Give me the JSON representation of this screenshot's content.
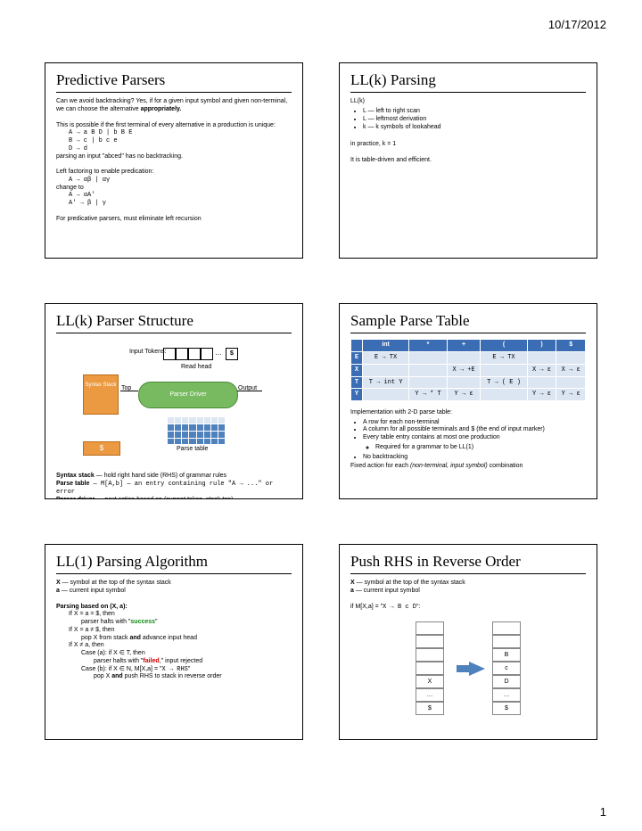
{
  "header_date": "10/17/2012",
  "footer_page": "1",
  "s1": {
    "title": "Predictive Parsers",
    "p1a": "Can we avoid backtracking? Yes, if for a given input symbol and given non-terminal, we can choose the alternative ",
    "p1b": "appropriately.",
    "p2": "This is possible if the first terminal of every alternative in a production is unique:",
    "prod1": "A → a B D | b B E",
    "prod2": "B → c | b c e",
    "prod3": "D → d",
    "p3": "parsing an input \"abced\" has no backtracking.",
    "p4": "Left factoring to enable predication:",
    "prod4": "A → αβ | αγ",
    "p5": "change to",
    "prod5": "A → αA'",
    "prod6": "A' → β | γ",
    "p6": "For predicative parsers, must eliminate left recursion"
  },
  "s2": {
    "title": "LL(k) Parsing",
    "h": "LL(k)",
    "li1": "L — left to right scan",
    "li2": "L — leftmost derivation",
    "li3": "k — k symbols of lookahead",
    "p1": "in practice, k = 1",
    "p2": "It is table-driven and efficient."
  },
  "s3": {
    "title": "LL(k) Parser Structure",
    "inputs": "Input Tokens:",
    "dollar": "$",
    "readhead": "Read head",
    "driver": "Parser Driver",
    "top": "Top",
    "output": "Output",
    "syntax": "Syntax Stack",
    "ptab": "Parse table",
    "n1a": "Syntax stack",
    "n1b": " — hold right hand side (RHS) of grammar rules",
    "n2a": "Parse table",
    "n2b": " — M[A,b] — an entry containing rule \"A → ...\" or error",
    "n3a": "Parser driver",
    "n3b": " — next action based on (current token, stack top)"
  },
  "s4": {
    "title": "Sample Parse Table",
    "tbl": {
      "cols": [
        "",
        "int",
        "*",
        "+",
        "(",
        ")",
        "$"
      ],
      "r1": [
        "E",
        "E → TX",
        "",
        "",
        "E → TX",
        "",
        ""
      ],
      "r2": [
        "X",
        "",
        "",
        "X → +E",
        "",
        "X → ε",
        "X → ε"
      ],
      "r3": [
        "T",
        "T → int Y",
        "",
        "",
        "T → ( E )",
        "",
        ""
      ],
      "r4": [
        "Y",
        "",
        "Y → * T",
        "Y → ε",
        "",
        "Y → ε",
        "Y → ε"
      ]
    },
    "p1": "Implementation with 2-D parse table:",
    "li1": "A row for each non-terminal",
    "li2": "A column for all possible terminals and $ (the end of input marker)",
    "li3": "Every table entry contains at most one production",
    "li3a": "Required for a grammar to be LL(1)",
    "li4": "No backtracking",
    "p2a": "Fixed action for each ",
    "p2b": "(non-terminal, input symbol)",
    "p2c": " combination"
  },
  "s5": {
    "title": "LL(1) Parsing Algorithm",
    "l1a": "X",
    "l1b": " — symbol at the top of the syntax stack",
    "l2a": "a",
    "l2b": " — current input symbol",
    "p1": "Parsing based on (X, a):",
    "c1": "If X = a = $, then",
    "c1r": "parser halts with \"success\"",
    "c2": "If X = a ≠ $, then",
    "c2r": "pop X from stack and advance input head",
    "c3": "If X ≠ a, then",
    "c3a": "Case (a): if X ∈ T, then",
    "c3a_r": "parser halts with \"failed,\" input rejected",
    "c3b": "Case (b): if X ∈ N, M[X,a] = \"X → RHS\"",
    "c3b_r": "pop X and push RHS to stack in reverse order"
  },
  "s6": {
    "title": "Push RHS in Reverse Order",
    "l1a": "X",
    "l1b": " — symbol at the top of the syntax stack",
    "l2a": "a",
    "l2b": " — current input symbol",
    "p1": "if M[X,a] = \"X → B c D\":",
    "left": [
      "",
      "",
      "",
      "",
      "X",
      "…",
      "$"
    ],
    "right": [
      "",
      "",
      "B",
      "c",
      "D",
      "…",
      "$"
    ]
  }
}
